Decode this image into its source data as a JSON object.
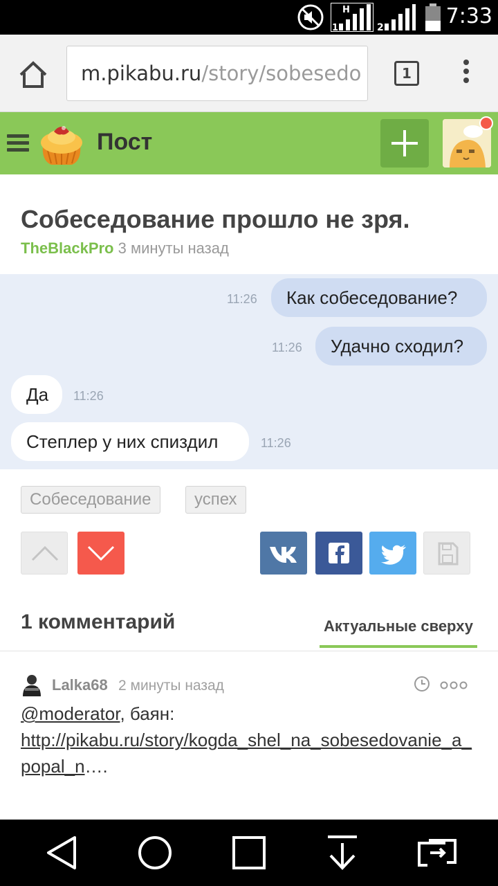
{
  "status_bar": {
    "time": "7:33",
    "signal_labels": [
      "H",
      "1",
      "2"
    ],
    "icons": [
      "mute-icon",
      "signal-sim1-icon",
      "signal-sim2-icon",
      "battery-icon"
    ]
  },
  "browser": {
    "url_host": "m.pikabu.ru",
    "url_path": "/story/sobesedo",
    "tab_count": "1"
  },
  "header": {
    "title": "Пост"
  },
  "post": {
    "title": "Собеседование прошло не зря.",
    "author": "TheBlackPro",
    "time_ago": "3 минуты назад"
  },
  "chat": {
    "messages": [
      {
        "text": "Как собеседование?",
        "time": "11:26",
        "side": "out"
      },
      {
        "text": "Удачно сходил?",
        "time": "11:26",
        "side": "out"
      },
      {
        "text": "Да",
        "time": "11:26",
        "side": "in"
      },
      {
        "text": "Степлер у них спиздил",
        "time": "11:26",
        "side": "in"
      }
    ]
  },
  "tags": [
    "Собеседование",
    "успех"
  ],
  "actions": {
    "colors": {
      "vk": "#4f77a6",
      "facebook": "#3b5998",
      "twitter": "#55acee",
      "downvote": "#f5594c",
      "upvote": "#ececec",
      "save": "#ececec"
    }
  },
  "comments": {
    "count_label": "1 комментарий",
    "sort_label": "Актуальные сверху",
    "items": [
      {
        "user": "Lalka68",
        "time_ago": "2 минуты назад",
        "mention": "@moderator",
        "text": ", баян:",
        "link": "http://pikabu.ru/story/kogda_shel_na_sobesedovanie_a_popal_n",
        "link_suffix": "…."
      }
    ]
  },
  "colors": {
    "accent_green": "#8ac858",
    "author_green": "#7bbf4c",
    "chat_bg": "#e8eef8",
    "bubble_out": "#cfdcf2"
  }
}
